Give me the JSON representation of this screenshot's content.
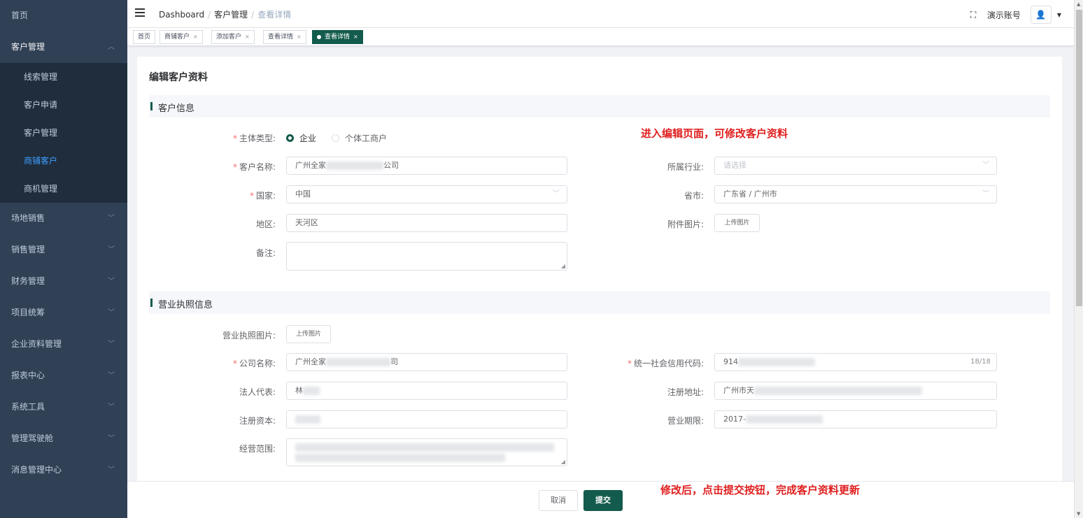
{
  "sidebar": {
    "home": "首页",
    "customer_group": "客户管理",
    "sub_items": [
      "线索管理",
      "客户申请",
      "客户管理",
      "商铺客户",
      "商机管理"
    ],
    "active_sub": 3,
    "groups": [
      "场地销售",
      "销售管理",
      "财务管理",
      "项目统筹",
      "企业资料管理",
      "报表中心",
      "系统工具",
      "管理驾驶舱",
      "消息管理中心"
    ]
  },
  "header": {
    "breadcrumb": [
      "Dashboard",
      "客户管理",
      "查看详情"
    ],
    "account_name": "演示账号"
  },
  "tags": [
    {
      "label": "首页",
      "closable": false,
      "active": false
    },
    {
      "label": "商铺客户",
      "closable": true,
      "active": false
    },
    {
      "label": "添加客户",
      "closable": true,
      "active": false
    },
    {
      "label": "查看详情",
      "closable": true,
      "active": false
    },
    {
      "label": "查看详情",
      "closable": true,
      "active": true
    }
  ],
  "tag_close": "×",
  "page_title": "编辑客户资料",
  "section_customer": "客户信息",
  "section_license": "营业执照信息",
  "form": {
    "subject_type_label": "主体类型:",
    "subject_options": [
      "企业",
      "个体工商户"
    ],
    "subject_selected": 0,
    "customer_name_label": "客户名称:",
    "customer_name_start": "广州全家",
    "customer_name_end": "公司",
    "industry_label": "所属行业:",
    "industry_placeholder": "请选择",
    "country_label": "国家:",
    "country_value": "中国",
    "province_label": "省市:",
    "province_value": "广东省 / 广州市",
    "district_label": "地区:",
    "district_value": "天河区",
    "attachment_label": "附件图片:",
    "upload_label": "上传图片",
    "remark_label": "备注:",
    "license_image_label": "营业执照图片:",
    "company_name_label": "公司名称:",
    "company_name_start": "广州全家",
    "company_name_end": "司",
    "credit_code_label": "统一社会信用代码:",
    "credit_code_start": "914",
    "credit_code_counter": "18/18",
    "legal_rep_label": "法人代表:",
    "legal_rep_start": "林",
    "reg_address_label": "注册地址:",
    "reg_address_start": "广州市天",
    "reg_capital_label": "注册资本:",
    "business_term_label": "营业期限:",
    "business_term_start": "2017-",
    "scope_label": "经营范围:"
  },
  "annotations": {
    "top": "进入编辑页面，可修改客户资料",
    "bottom": "修改后，点击提交按钮，完成客户资料更新"
  },
  "footer": {
    "cancel": "取消",
    "submit": "提交"
  },
  "colors": {
    "sidebar_bg": "#304156",
    "brand": "#135b4c",
    "required": "#f56c6c",
    "annotation": "#e02020"
  }
}
